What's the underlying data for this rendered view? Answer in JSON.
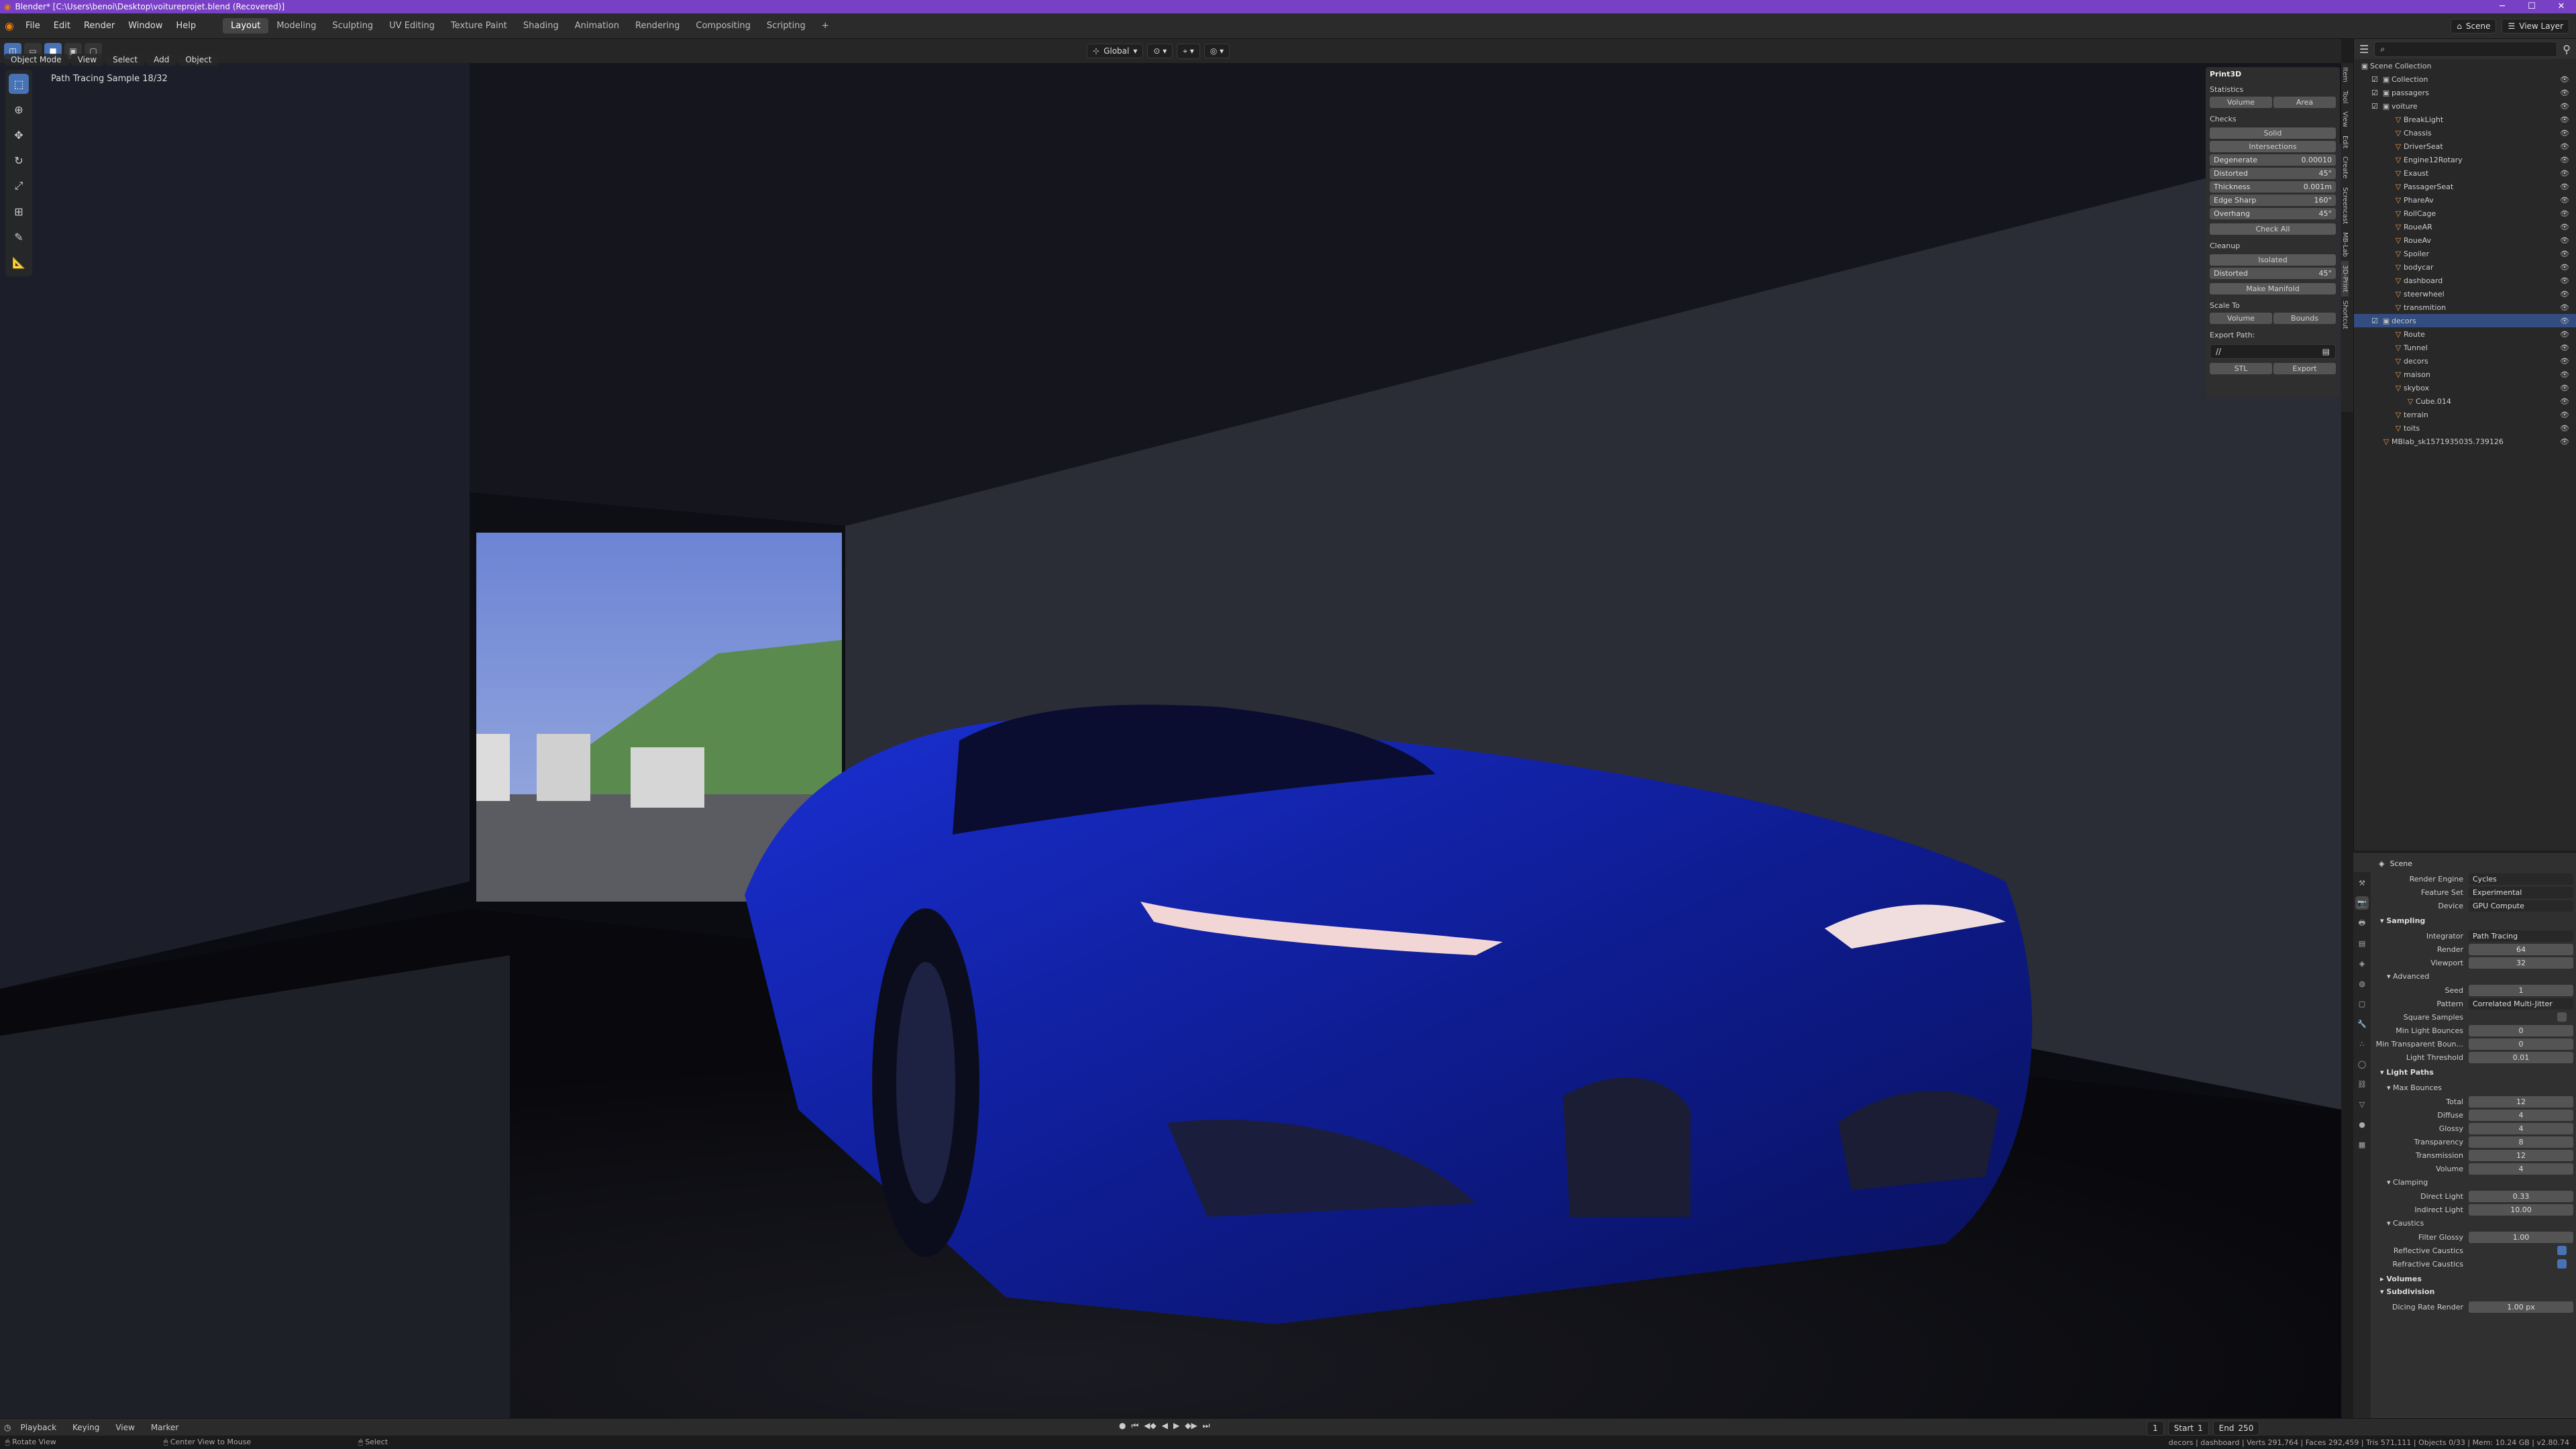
{
  "titlebar": {
    "title": "Blender* [C:\\Users\\benoi\\Desktop\\voitureprojet.blend (Recovered)]"
  },
  "menu": {
    "items": [
      "File",
      "Edit",
      "Render",
      "Window",
      "Help"
    ]
  },
  "workspaces": [
    "Layout",
    "Modeling",
    "Sculpting",
    "UV Editing",
    "Texture Paint",
    "Shading",
    "Animation",
    "Rendering",
    "Compositing",
    "Scripting"
  ],
  "scene": {
    "label": "Scene",
    "view_layer": "View Layer"
  },
  "header": {
    "mode": "Object Mode",
    "view": "View",
    "select": "Select",
    "add": "Add",
    "object": "Object",
    "transform": "Global"
  },
  "viewport": {
    "info": "Path Tracing Sample 18/32"
  },
  "sidetabs": [
    "Item",
    "Tool",
    "View",
    "Edit",
    "Create",
    "Screencast",
    "MB-Lab",
    "3D-Print",
    "Shortcut"
  ],
  "print3d": {
    "title": "Print3D",
    "statistics": "Statistics",
    "volume": "Volume",
    "area": "Area",
    "checks": "Checks",
    "solid": "Solid",
    "intersections": "Intersections",
    "checks_rows": [
      {
        "label": "Degenerate",
        "value": "0.00010"
      },
      {
        "label": "Distorted",
        "value": "45°"
      },
      {
        "label": "Thickness",
        "value": "0.001m"
      },
      {
        "label": "Edge Sharp",
        "value": "160°"
      },
      {
        "label": "Overhang",
        "value": "45°"
      }
    ],
    "check_all": "Check All",
    "cleanup": "Cleanup",
    "isolated": "Isolated",
    "distorted": "Distorted",
    "distorted_value": "45°",
    "make_manifold": "Make Manifold",
    "scale_to": "Scale To",
    "bounds": "Bounds",
    "export_path": "Export Path:",
    "path_value": "//",
    "format": "STL",
    "export": "Export"
  },
  "outliner": {
    "title": "Scene Collection",
    "rows": [
      {
        "name": "Collection",
        "depth": 1,
        "type": "col"
      },
      {
        "name": "passagers",
        "depth": 1,
        "type": "col"
      },
      {
        "name": "voiture",
        "depth": 1,
        "type": "col"
      },
      {
        "name": "BreakLight",
        "depth": 2,
        "type": "obj"
      },
      {
        "name": "Chassis",
        "depth": 2,
        "type": "obj"
      },
      {
        "name": "DriverSeat",
        "depth": 2,
        "type": "obj"
      },
      {
        "name": "Engine12Rotary",
        "depth": 2,
        "type": "obj"
      },
      {
        "name": "Exaust",
        "depth": 2,
        "type": "obj"
      },
      {
        "name": "PassagerSeat",
        "depth": 2,
        "type": "obj"
      },
      {
        "name": "PhareAv",
        "depth": 2,
        "type": "obj"
      },
      {
        "name": "RollCage",
        "depth": 2,
        "type": "obj"
      },
      {
        "name": "RoueAR",
        "depth": 2,
        "type": "obj"
      },
      {
        "name": "RoueAv",
        "depth": 2,
        "type": "obj"
      },
      {
        "name": "Spoiler",
        "depth": 2,
        "type": "obj"
      },
      {
        "name": "bodycar",
        "depth": 2,
        "type": "obj"
      },
      {
        "name": "dashboard",
        "depth": 2,
        "type": "obj"
      },
      {
        "name": "steerwheel",
        "depth": 2,
        "type": "obj"
      },
      {
        "name": "transmition",
        "depth": 2,
        "type": "obj"
      },
      {
        "name": "decors",
        "depth": 1,
        "type": "col",
        "sel": true
      },
      {
        "name": "Route",
        "depth": 2,
        "type": "obj"
      },
      {
        "name": "Tunnel",
        "depth": 2,
        "type": "obj"
      },
      {
        "name": "decors",
        "depth": 2,
        "type": "obj"
      },
      {
        "name": "maison",
        "depth": 2,
        "type": "obj"
      },
      {
        "name": "skybox",
        "depth": 2,
        "type": "obj"
      },
      {
        "name": "Cube.014",
        "depth": 3,
        "type": "obj"
      },
      {
        "name": "terrain",
        "depth": 2,
        "type": "obj"
      },
      {
        "name": "toits",
        "depth": 2,
        "type": "obj"
      },
      {
        "name": "MBlab_sk1571935035.739126",
        "depth": 1,
        "type": "obj"
      }
    ]
  },
  "properties": {
    "scene": "Scene",
    "top": [
      {
        "label": "Render Engine",
        "value": "Cycles"
      },
      {
        "label": "Feature Set",
        "value": "Experimental"
      },
      {
        "label": "Device",
        "value": "GPU Compute"
      }
    ],
    "sampling": "Sampling",
    "sampling_rows": [
      {
        "label": "Integrator",
        "value": "Path Tracing"
      },
      {
        "label": "Render",
        "value": "64"
      },
      {
        "label": "Viewport",
        "value": "32"
      }
    ],
    "advanced": "Advanced",
    "advanced_rows": [
      {
        "label": "Seed",
        "value": "1"
      },
      {
        "label": "Pattern",
        "value": "Correlated Multi-Jitter"
      }
    ],
    "square_samples": "Square Samples",
    "advanced_rows2": [
      {
        "label": "Min Light Bounces",
        "value": "0"
      },
      {
        "label": "Min Transparent Boun...",
        "value": "0"
      },
      {
        "label": "Light Threshold",
        "value": "0.01"
      }
    ],
    "light_paths": "Light Paths",
    "max_bounces": "Max Bounces",
    "bounce_rows": [
      {
        "label": "Total",
        "value": "12"
      },
      {
        "label": "Diffuse",
        "value": "4"
      },
      {
        "label": "Glossy",
        "value": "4"
      },
      {
        "label": "Transparency",
        "value": "8"
      },
      {
        "label": "Transmission",
        "value": "12"
      },
      {
        "label": "Volume",
        "value": "4"
      }
    ],
    "clamping": "Clamping",
    "clamp_rows": [
      {
        "label": "Direct Light",
        "value": "0.33"
      },
      {
        "label": "Indirect Light",
        "value": "10.00"
      }
    ],
    "caustics": "Caustics",
    "filter_glossy": {
      "label": "Filter Glossy",
      "value": "1.00"
    },
    "reflective": "Reflective Caustics",
    "refractive": "Refractive Caustics",
    "volumes": "Volumes",
    "subdivision": "Subdivision",
    "dicing": {
      "label": "Dicing Rate Render",
      "value": "1.00 px"
    }
  },
  "timeline": {
    "items": [
      "Playback",
      "Keying",
      "View",
      "Marker"
    ],
    "frame": "1",
    "start_label": "Start",
    "start": "1",
    "end_label": "End",
    "end": "250"
  },
  "status": {
    "left": "Rotate View",
    "mid": "Center View to Mouse",
    "right": "Select",
    "stats": "decors | dashboard | Verts 291,764 | Faces 292,459 | Tris 571,111 | Objects 0/33 | Mem: 10.24 GB | v2.80.74"
  },
  "colors": {
    "accent": "#4772b3",
    "titlebar": "#7840c4",
    "car": "#1428b4"
  }
}
